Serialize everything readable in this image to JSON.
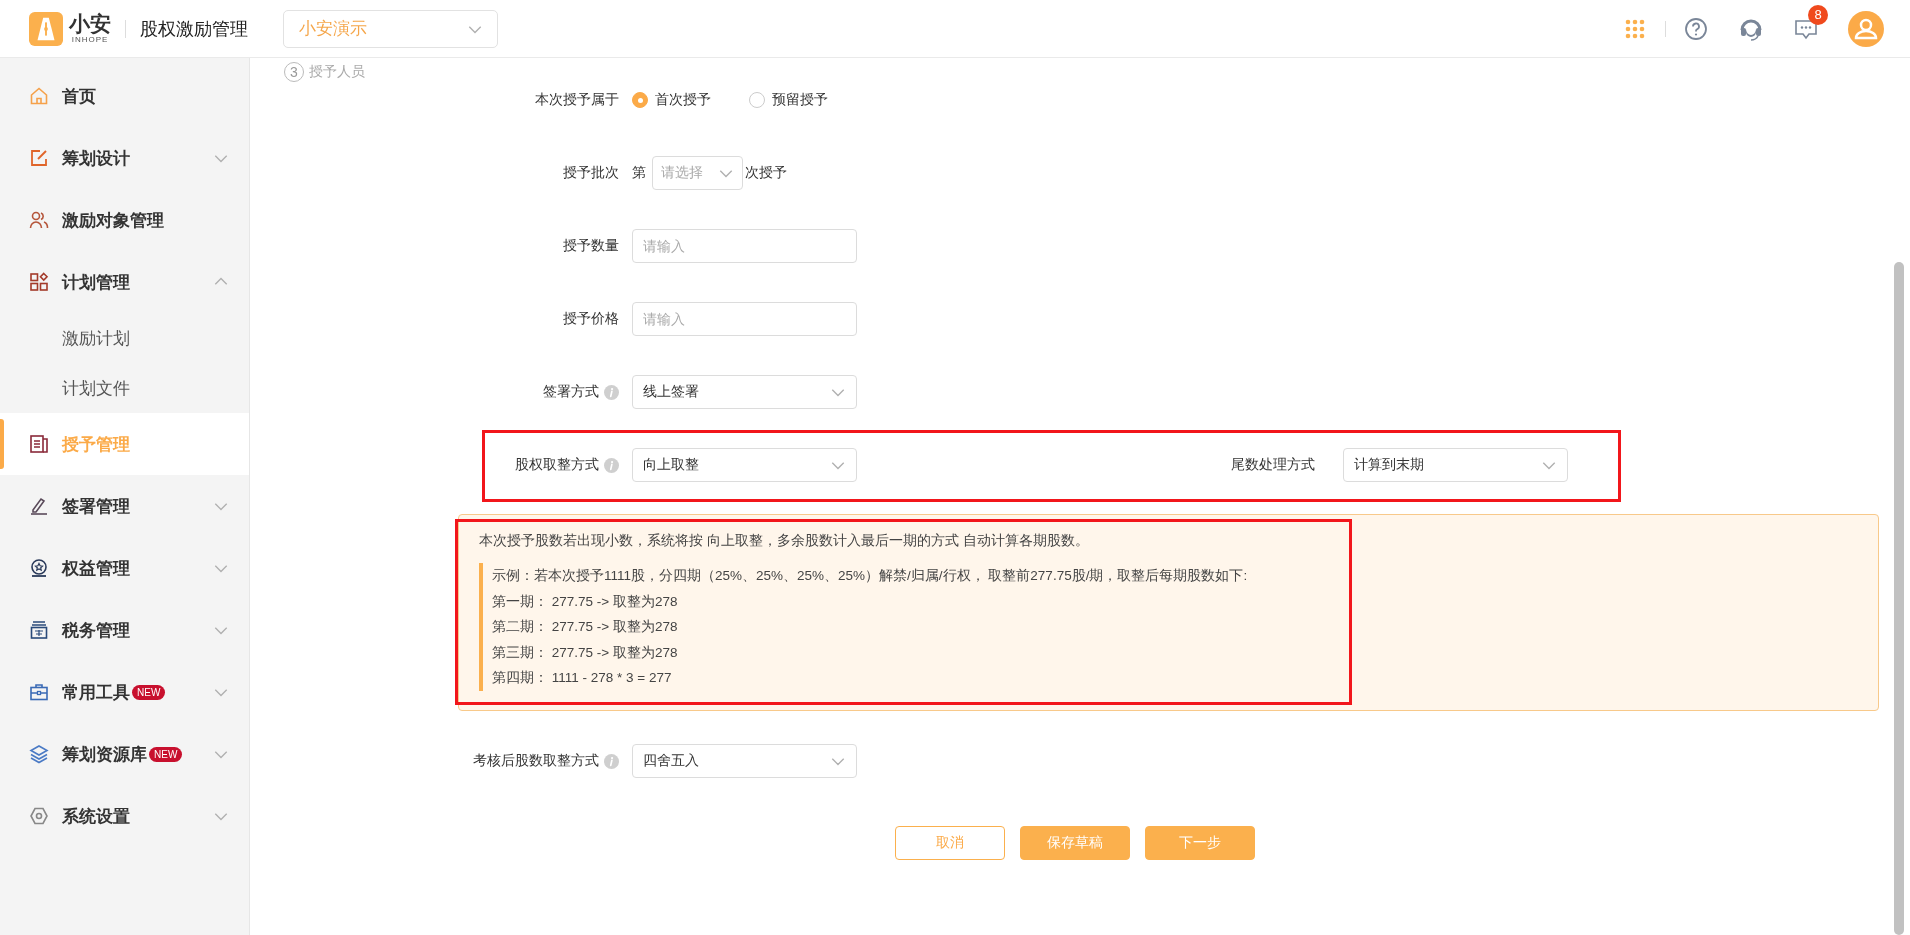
{
  "header": {
    "logo_text": "小安",
    "logo_subtext": "INHOPE",
    "app_title": "股权激励管理",
    "company_select": {
      "value": "小安演示"
    },
    "notification_count": "8"
  },
  "sidebar": {
    "items": [
      {
        "label": "首页",
        "kind": "link",
        "selected": false
      },
      {
        "label": "筹划设计",
        "kind": "group",
        "selected": false,
        "expanded": false
      },
      {
        "label": "激励对象管理",
        "kind": "link",
        "selected": false
      },
      {
        "label": "计划管理",
        "kind": "group",
        "selected": false,
        "expanded": true,
        "children": [
          {
            "label": "激励计划",
            "selected": false
          },
          {
            "label": "计划文件",
            "selected": false
          }
        ]
      },
      {
        "label": "授予管理",
        "kind": "link",
        "selected": true
      },
      {
        "label": "签署管理",
        "kind": "group",
        "selected": false,
        "expanded": false
      },
      {
        "label": "权益管理",
        "kind": "group",
        "selected": false,
        "expanded": false
      },
      {
        "label": "税务管理",
        "kind": "group",
        "selected": false,
        "expanded": false
      },
      {
        "label": "常用工具",
        "kind": "group",
        "selected": false,
        "expanded": false,
        "badge": "NEW"
      },
      {
        "label": "筹划资源库",
        "kind": "group",
        "selected": false,
        "expanded": false,
        "badge": "NEW"
      },
      {
        "label": "系统设置",
        "kind": "group",
        "selected": false,
        "expanded": false
      }
    ]
  },
  "step": {
    "number": "3",
    "label": "授予人员"
  },
  "form": {
    "rows": [
      {
        "kind": "radio",
        "label": "本次授予属于",
        "options": [
          {
            "label": "首次授予",
            "selected": true
          },
          {
            "label": "预留授予",
            "selected": false
          }
        ]
      },
      {
        "kind": "batch",
        "label": "授予批次",
        "prefix": "第",
        "placeholder": "请选择",
        "suffix": "次授予"
      },
      {
        "kind": "input",
        "label": "授予数量",
        "placeholder": "请输入"
      },
      {
        "kind": "input",
        "label": "授予价格",
        "placeholder": "请输入"
      },
      {
        "kind": "select",
        "label": "签署方式",
        "info": true,
        "value": "线上签署"
      },
      {
        "kind": "pair",
        "label": "股权取整方式",
        "info": true,
        "value": "向上取整",
        "second_label": "尾数处理方式",
        "second_value": "计算到末期",
        "highlighted": true
      },
      {
        "kind": "notice",
        "text": "本次授予股数若出现小数，系统将按 向上取整，多余股数计入最后一期的方式 自动计算各期股数。",
        "highlighted": true,
        "example_lines": [
          "示例：若本次授予1111股，分四期（25%、25%、25%、25%）解禁/归属/行权， 取整前277.75股/期，取整后每期股数如下:",
          "第一期： 277.75 -> 取整为278",
          "第二期： 277.75 -> 取整为278",
          "第三期： 277.75 -> 取整为278",
          "第四期： 1111 - 278 * 3 = 277"
        ]
      },
      {
        "kind": "select",
        "label": "考核后股数取整方式",
        "info": true,
        "value": "四舍五入"
      }
    ],
    "buttons": [
      {
        "label": "取消",
        "kind": "secondary"
      },
      {
        "label": "保存草稿",
        "kind": "primary"
      },
      {
        "label": "下一步",
        "kind": "primary"
      }
    ]
  }
}
